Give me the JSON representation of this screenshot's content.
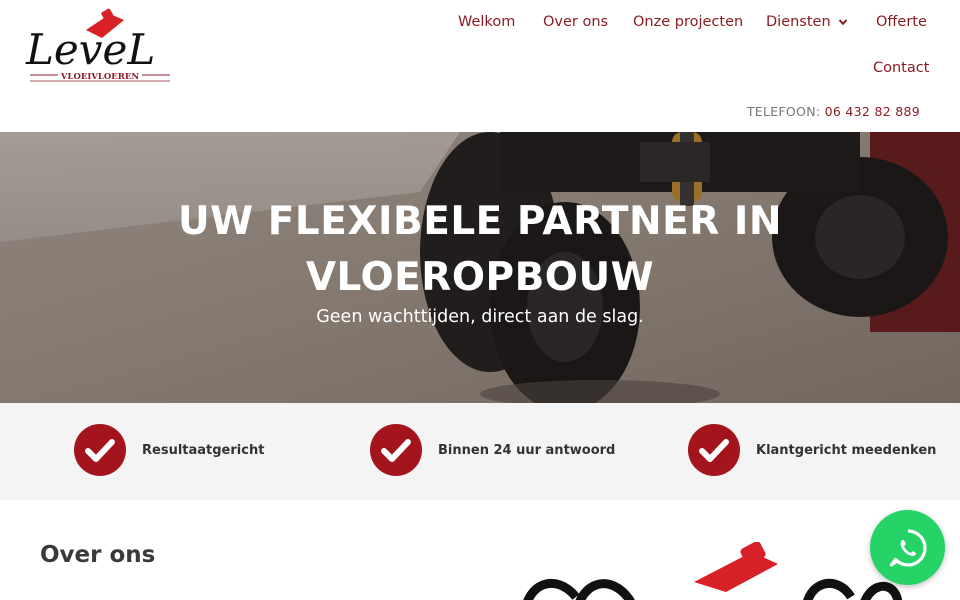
{
  "brand": {
    "logo_text": "LeveL",
    "logo_subtext": "VLOEIVLOEREN",
    "accent_color": "#a3141d",
    "nav_color": "#8c1c24"
  },
  "nav": {
    "items": [
      {
        "label": "Welkom"
      },
      {
        "label": "Over ons"
      },
      {
        "label": "Onze projecten"
      },
      {
        "label": "Diensten",
        "icon": "chevron-down-icon"
      },
      {
        "label": "Offerte"
      },
      {
        "label": "Contact"
      }
    ]
  },
  "contact": {
    "phone_label": "TELEFOON:",
    "phone_number": "06 432 82 889"
  },
  "hero": {
    "title_line1": "UW FLEXIBELE PARTNER IN",
    "title_line2": "VLOEROPBOUW",
    "subtitle": "Geen wachttijden, direct aan de slag."
  },
  "features": [
    {
      "label": "Resultaatgericht",
      "icon": "check-icon"
    },
    {
      "label": "Binnen 24 uur antwoord",
      "icon": "check-icon"
    },
    {
      "label": "Klantgericht meedenken",
      "icon": "check-icon"
    }
  ],
  "about": {
    "title": "Over ons"
  },
  "whatsapp": {
    "icon": "whatsapp-icon",
    "color": "#25d366"
  }
}
